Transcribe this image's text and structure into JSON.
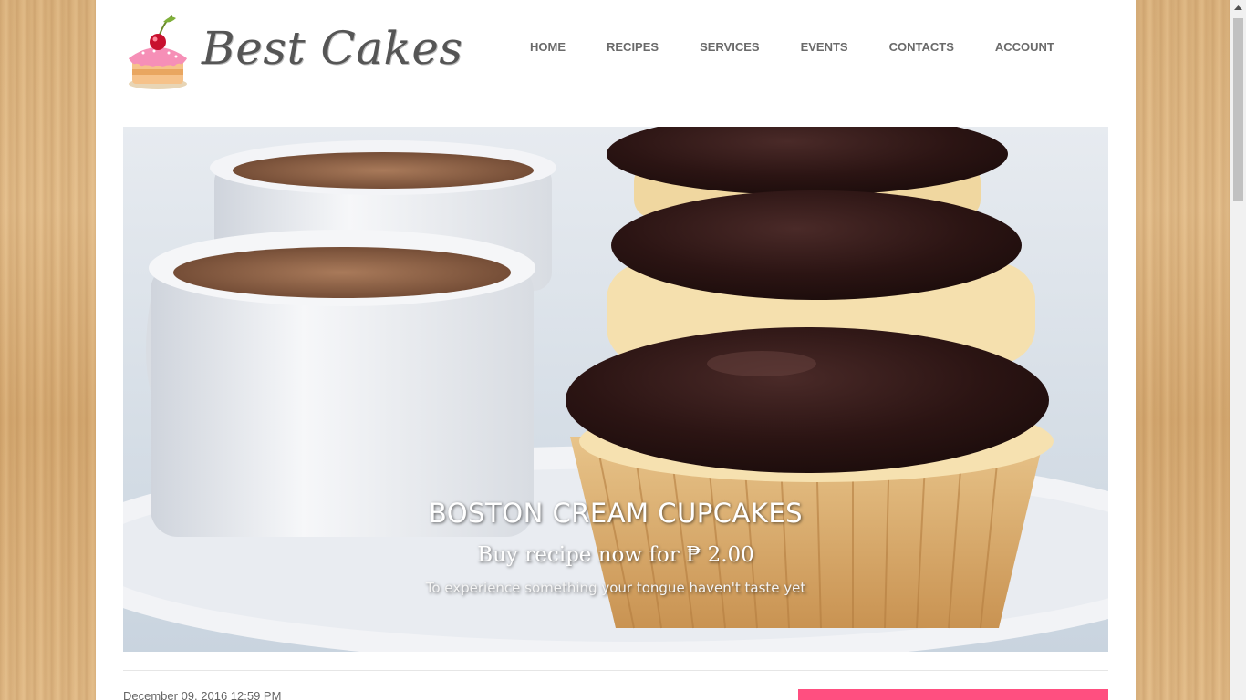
{
  "site": {
    "logo_text": "Best Cakes"
  },
  "nav": {
    "items": [
      {
        "label": "HOME"
      },
      {
        "label": "RECIPES"
      },
      {
        "label": "SERVICES"
      },
      {
        "label": "EVENTS"
      },
      {
        "label": "CONTACTS"
      },
      {
        "label": "ACCOUNT"
      }
    ]
  },
  "hero": {
    "title": "BOSTON CREAM CUPCAKES",
    "price_line": "Buy recipe now for ₱ 2.00",
    "subtitle": "To experience something your tongue haven't taste yet"
  },
  "post": {
    "date": "December 09, 2016 12:59 PM"
  },
  "colors": {
    "accent": "#ff4f80",
    "nav_text": "#6a6a6a"
  },
  "icons": {
    "logo": "cupcake-cherry-icon",
    "scroll_up": "arrow-up-icon"
  }
}
